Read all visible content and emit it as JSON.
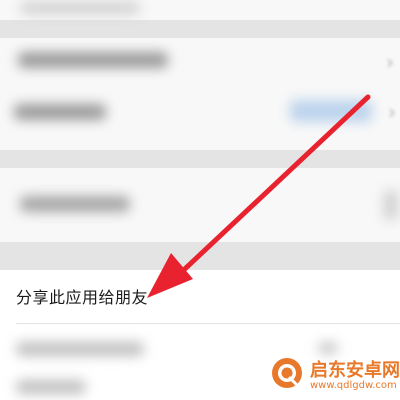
{
  "share_row": {
    "label": "分享此应用给朋友"
  },
  "watermark": {
    "title": "启东安卓网",
    "url": "www.qdlgdw.com",
    "brand_color": "#e8792b"
  },
  "annotation": {
    "arrow_color": "#e8222e"
  }
}
